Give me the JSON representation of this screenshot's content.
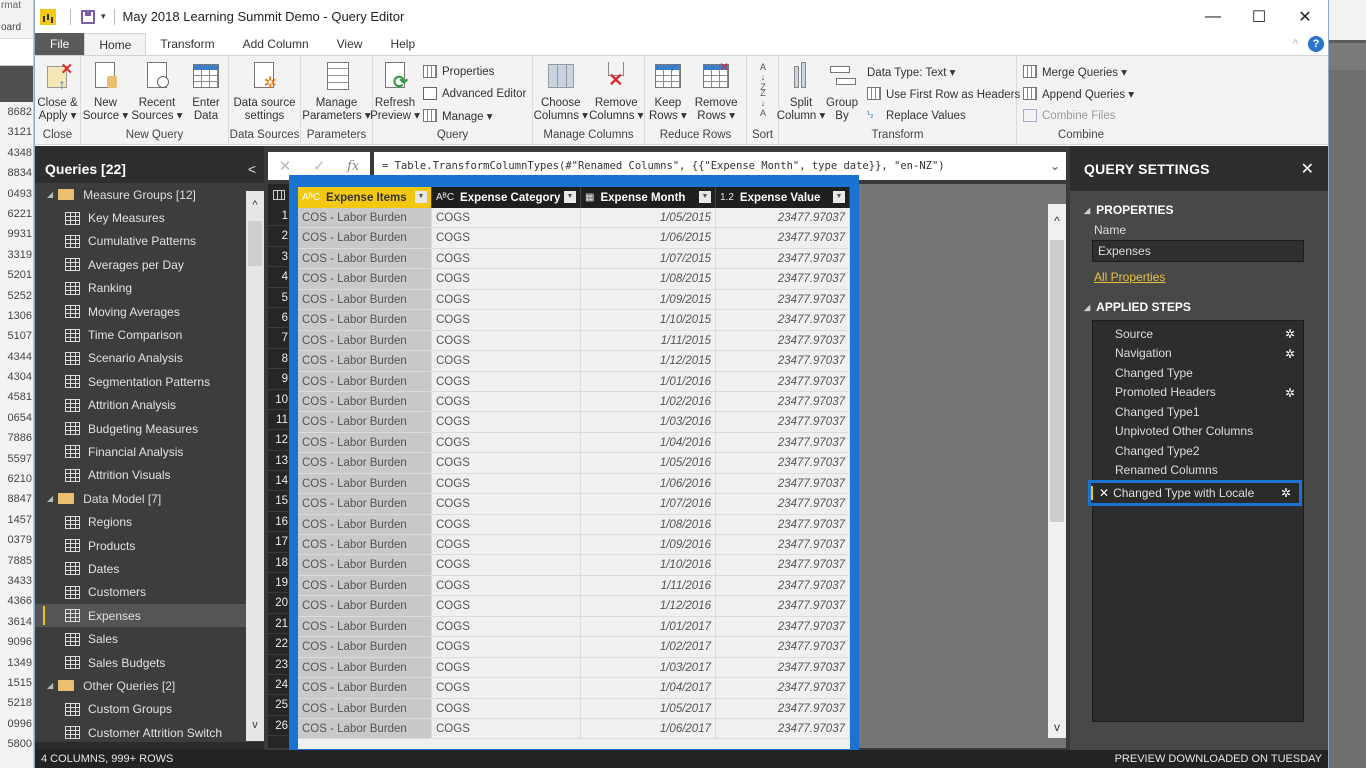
{
  "background_app": {
    "partial_labels": [
      "rmat",
      "oard"
    ],
    "partial_numbers": [
      "8682",
      "3121",
      "4348",
      "8834",
      "0493",
      "6221",
      "9931",
      "3319",
      "5201",
      "5252",
      "1306",
      "5107",
      "4344",
      "4304",
      "4581",
      "0654",
      "7886",
      "5597",
      "6210",
      "8847",
      "1457",
      "0379",
      "7885",
      "3433",
      "4366",
      "3614",
      "9096",
      "1349",
      "1515",
      "5218",
      "0996",
      "5800"
    ]
  },
  "window": {
    "title": "May 2018 Learning Summit Demo - Query Editor",
    "controls": {
      "minimize": "—",
      "maximize": "☐",
      "close": "✕"
    }
  },
  "tabs": [
    {
      "label": "File"
    },
    {
      "label": "Home",
      "active": true
    },
    {
      "label": "Transform"
    },
    {
      "label": "Add Column"
    },
    {
      "label": "View"
    },
    {
      "label": "Help"
    }
  ],
  "ribbon": {
    "groups": {
      "close": {
        "label": "Close",
        "close_apply": "Close &\nApply ▾"
      },
      "new_query": {
        "label": "New Query",
        "new_source": "New\nSource ▾",
        "recent_sources": "Recent\nSources ▾",
        "enter_data": "Enter\nData"
      },
      "data_sources": {
        "label": "Data Sources",
        "settings": "Data source\nsettings"
      },
      "parameters": {
        "label": "Parameters",
        "manage": "Manage\nParameters ▾"
      },
      "query": {
        "label": "Query",
        "refresh": "Refresh\nPreview ▾",
        "properties": "Properties",
        "advanced_editor": "Advanced Editor",
        "manage": "Manage ▾"
      },
      "manage_columns": {
        "label": "Manage Columns",
        "choose": "Choose\nColumns ▾",
        "remove": "Remove\nColumns ▾"
      },
      "reduce_rows": {
        "label": "Reduce Rows",
        "keep": "Keep\nRows ▾",
        "remove": "Remove\nRows ▾"
      },
      "sort": {
        "label": "Sort",
        "asc": "A↓Z",
        "desc": "Z↓A"
      },
      "transform": {
        "label": "Transform",
        "split": "Split\nColumn ▾",
        "group": "Group\nBy",
        "data_type": "Data Type: Text ▾",
        "first_row": "Use First Row as Headers ▾",
        "replace": "Replace Values"
      },
      "combine": {
        "label": "Combine",
        "merge": "Merge Queries ▾",
        "append": "Append Queries ▾",
        "combine_files": "Combine Files"
      }
    }
  },
  "queries_pane": {
    "title": "Queries [22]",
    "groups": [
      {
        "name": "Measure Groups [12]",
        "items": [
          "Key Measures",
          "Cumulative Patterns",
          "Averages per Day",
          "Ranking",
          "Moving Averages",
          "Time Comparison",
          "Scenario Analysis",
          "Segmentation Patterns",
          "Attrition Analysis",
          "Budgeting Measures",
          "Financial Analysis",
          "Attrition Visuals"
        ]
      },
      {
        "name": "Data Model [7]",
        "items": [
          "Regions",
          "Products",
          "Dates",
          "Customers",
          "Expenses",
          "Sales",
          "Sales Budgets"
        ]
      },
      {
        "name": "Other Queries [2]",
        "items": [
          "Custom Groups",
          "Customer Attrition Switch"
        ]
      }
    ],
    "selected": "Expenses"
  },
  "formula_bar": {
    "formula": "= Table.TransformColumnTypes(#\"Renamed Columns\", {{\"Expense Month\", type date}}, \"en-NZ\")"
  },
  "table": {
    "columns": [
      {
        "type": "ABC",
        "name": "Expense Items"
      },
      {
        "type": "ABC",
        "name": "Expense Category"
      },
      {
        "type": "date",
        "name": "Expense Month"
      },
      {
        "type": "1.2",
        "name": "Expense Value"
      }
    ],
    "rows": [
      [
        "COS - Labor Burden",
        "COGS",
        "1/05/2015",
        "23477.97037"
      ],
      [
        "COS - Labor Burden",
        "COGS",
        "1/06/2015",
        "23477.97037"
      ],
      [
        "COS - Labor Burden",
        "COGS",
        "1/07/2015",
        "23477.97037"
      ],
      [
        "COS - Labor Burden",
        "COGS",
        "1/08/2015",
        "23477.97037"
      ],
      [
        "COS - Labor Burden",
        "COGS",
        "1/09/2015",
        "23477.97037"
      ],
      [
        "COS - Labor Burden",
        "COGS",
        "1/10/2015",
        "23477.97037"
      ],
      [
        "COS - Labor Burden",
        "COGS",
        "1/11/2015",
        "23477.97037"
      ],
      [
        "COS - Labor Burden",
        "COGS",
        "1/12/2015",
        "23477.97037"
      ],
      [
        "COS - Labor Burden",
        "COGS",
        "1/01/2016",
        "23477.97037"
      ],
      [
        "COS - Labor Burden",
        "COGS",
        "1/02/2016",
        "23477.97037"
      ],
      [
        "COS - Labor Burden",
        "COGS",
        "1/03/2016",
        "23477.97037"
      ],
      [
        "COS - Labor Burden",
        "COGS",
        "1/04/2016",
        "23477.97037"
      ],
      [
        "COS - Labor Burden",
        "COGS",
        "1/05/2016",
        "23477.97037"
      ],
      [
        "COS - Labor Burden",
        "COGS",
        "1/06/2016",
        "23477.97037"
      ],
      [
        "COS - Labor Burden",
        "COGS",
        "1/07/2016",
        "23477.97037"
      ],
      [
        "COS - Labor Burden",
        "COGS",
        "1/08/2016",
        "23477.97037"
      ],
      [
        "COS - Labor Burden",
        "COGS",
        "1/09/2016",
        "23477.97037"
      ],
      [
        "COS - Labor Burden",
        "COGS",
        "1/10/2016",
        "23477.97037"
      ],
      [
        "COS - Labor Burden",
        "COGS",
        "1/11/2016",
        "23477.97037"
      ],
      [
        "COS - Labor Burden",
        "COGS",
        "1/12/2016",
        "23477.97037"
      ],
      [
        "COS - Labor Burden",
        "COGS",
        "1/01/2017",
        "23477.97037"
      ],
      [
        "COS - Labor Burden",
        "COGS",
        "1/02/2017",
        "23477.97037"
      ],
      [
        "COS - Labor Burden",
        "COGS",
        "1/03/2017",
        "23477.97037"
      ],
      [
        "COS - Labor Burden",
        "COGS",
        "1/04/2017",
        "23477.97037"
      ],
      [
        "COS - Labor Burden",
        "COGS",
        "1/05/2017",
        "23477.97037"
      ],
      [
        "COS - Labor Burden",
        "COGS",
        "1/06/2017",
        "23477.97037"
      ]
    ]
  },
  "settings_pane": {
    "title": "QUERY SETTINGS",
    "properties_header": "PROPERTIES",
    "name_label": "Name",
    "name_value": "Expenses",
    "all_properties": "All Properties",
    "applied_steps_header": "APPLIED STEPS",
    "steps": [
      {
        "label": "Source",
        "gear": true
      },
      {
        "label": "Navigation",
        "gear": true
      },
      {
        "label": "Changed Type",
        "gear": false
      },
      {
        "label": "Promoted Headers",
        "gear": true
      },
      {
        "label": "Changed Type1",
        "gear": false
      },
      {
        "label": "Unpivoted Other Columns",
        "gear": false
      },
      {
        "label": "Changed Type2",
        "gear": false
      },
      {
        "label": "Renamed Columns",
        "gear": false
      },
      {
        "label": "Changed Type with Locale",
        "gear": true,
        "selected": true
      }
    ]
  },
  "status_bar": {
    "left": "4 COLUMNS, 999+ ROWS",
    "right": "PREVIEW DOWNLOADED ON TUESDAY"
  },
  "colors": {
    "accent_yellow": "#f2c811",
    "highlight_blue": "#1a73d0",
    "help_blue": "#2a74c9"
  }
}
